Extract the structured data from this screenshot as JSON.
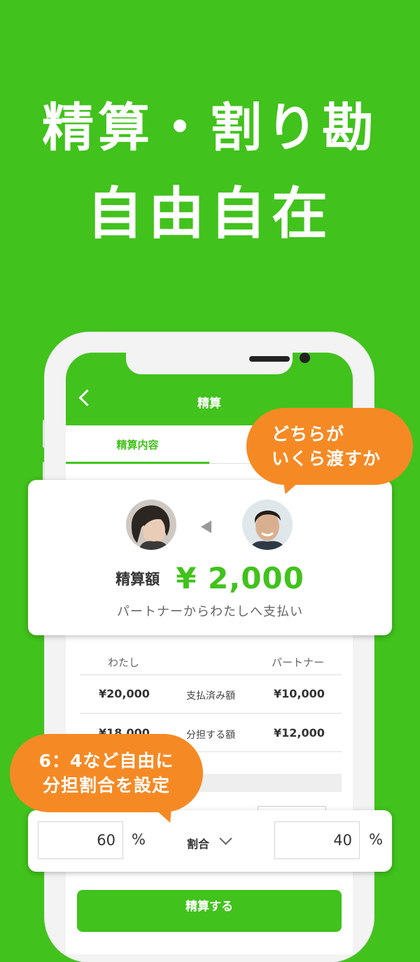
{
  "headline": {
    "line1": "精算・割り勘",
    "line2": "自由自在"
  },
  "screen": {
    "title": "精算",
    "tab_active": "精算内容"
  },
  "bubbles": {
    "top": {
      "line1": "どちらが",
      "line2": "いくら渡すか"
    },
    "bottom": {
      "line1": "6：4など自由に",
      "line2": "分担割合を設定"
    }
  },
  "summary": {
    "amount_label": "精算額",
    "amount_value": "¥ 2,000",
    "note": "パートナーからわたしへ支払い"
  },
  "table": {
    "col_me": "わたし",
    "col_partner": "パートナー",
    "rows": [
      {
        "me": "¥20,000",
        "label": "支払済み額",
        "partner": "¥10,000"
      },
      {
        "me": "¥18,000",
        "label": "分担する額",
        "partner": "¥12,000"
      }
    ]
  },
  "ratio": {
    "me_value": "60",
    "partner_value": "40",
    "unit": "%",
    "label": "割合"
  },
  "button": {
    "settle": "精算する"
  },
  "colors": {
    "brand_green": "#41c21c",
    "bubble_orange": "#f58a25"
  }
}
